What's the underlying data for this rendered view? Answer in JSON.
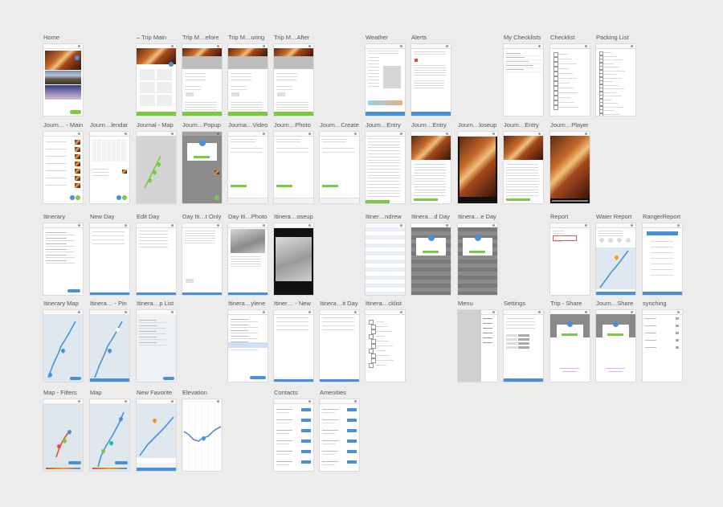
{
  "colors": {
    "accent": "#4a90d9",
    "green": "#7ac943",
    "canvas": "#ececec"
  },
  "boards": [
    {
      "label": "Home"
    },
    {
      "label": "– Trip Main"
    },
    {
      "label": "Trip M…efore"
    },
    {
      "label": "Trip M…uring"
    },
    {
      "label": "Trip M…After"
    },
    {
      "label": "Weather"
    },
    {
      "label": "Alerts"
    },
    {
      "label": "My Checklists"
    },
    {
      "label": "Checklist"
    },
    {
      "label": "Packing List"
    },
    {
      "label": "Journ… - Main"
    },
    {
      "label": "Journ…lendar"
    },
    {
      "label": "Journal - Map"
    },
    {
      "label": "Journ…Popup"
    },
    {
      "label": "Journa…Video"
    },
    {
      "label": "Journ…Photo"
    },
    {
      "label": "Journ…Create"
    },
    {
      "label": "Journ…Entry"
    },
    {
      "label": "Journ…Entry"
    },
    {
      "label": "Journ…loseup"
    },
    {
      "label": "Journ…Entry"
    },
    {
      "label": "Journ…Player"
    },
    {
      "label": "Itinerary"
    },
    {
      "label": "New Day"
    },
    {
      "label": "Edit Day"
    },
    {
      "label": "Day Iti…t Only"
    },
    {
      "label": "Day Iti…Photo"
    },
    {
      "label": "Itinera…oseup"
    },
    {
      "label": "Itiner…ndrew"
    },
    {
      "label": "Itinera…d Day"
    },
    {
      "label": "Itinera…e Day"
    },
    {
      "label": "Report"
    },
    {
      "label": "Water Report"
    },
    {
      "label": "RangerReport"
    },
    {
      "label": "Itinerary Map"
    },
    {
      "label": "Itinera… - Pin"
    },
    {
      "label": "Itinera…p List"
    },
    {
      "label": "Itinera…ylene"
    },
    {
      "label": "Itiner… - New"
    },
    {
      "label": "Itinera…it Day"
    },
    {
      "label": "Itinera…cklist"
    },
    {
      "label": "Menu"
    },
    {
      "label": "Settings"
    },
    {
      "label": "Trip - Share"
    },
    {
      "label": "Journ…Share"
    },
    {
      "label": "synching"
    },
    {
      "label": "Map - Filters"
    },
    {
      "label": "Map"
    },
    {
      "label": "New Favorite"
    },
    {
      "label": "Elevation"
    },
    {
      "label": "Contacts"
    },
    {
      "label": "Amenities"
    }
  ]
}
